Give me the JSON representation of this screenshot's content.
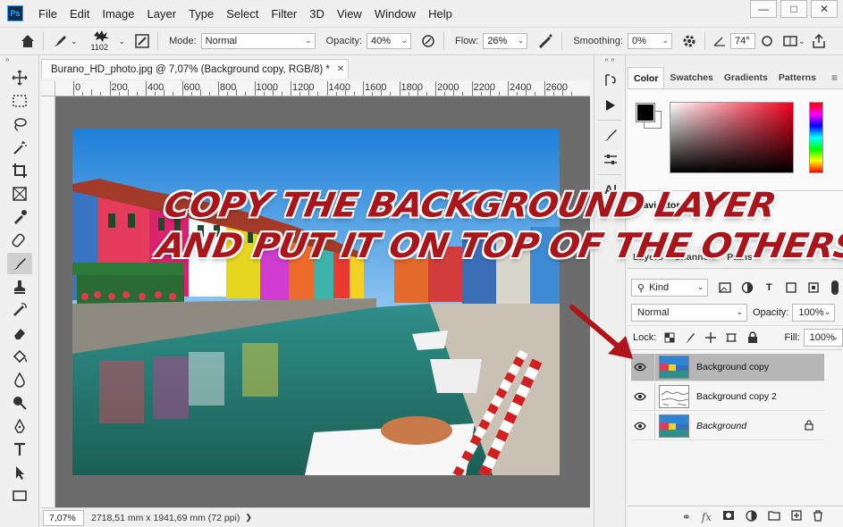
{
  "app": {
    "logo": "Ps",
    "menu": [
      "File",
      "Edit",
      "Image",
      "Layer",
      "Type",
      "Select",
      "Filter",
      "3D",
      "View",
      "Window",
      "Help"
    ],
    "window_controls": [
      "minimize-icon",
      "maximize-icon",
      "close-icon"
    ]
  },
  "options_bar": {
    "brush_size": "1102",
    "mode_label": "Mode:",
    "mode_value": "Normal",
    "opacity_label": "Opacity:",
    "opacity_value": "40%",
    "flow_label": "Flow:",
    "flow_value": "26%",
    "smoothing_label": "Smoothing:",
    "smoothing_value": "0%",
    "angle_value": "74°"
  },
  "tools": [
    "move-icon",
    "marquee-icon",
    "lasso-icon",
    "magic-wand-icon",
    "crop-icon",
    "frame-icon",
    "eyedropper-icon",
    "healing-brush-icon",
    "brush-icon",
    "clone-stamp-icon",
    "history-brush-icon",
    "eraser-icon",
    "paint-bucket-icon",
    "blur-icon",
    "dodge-icon",
    "pen-icon",
    "type-icon",
    "path-selection-icon",
    "rectangle-icon"
  ],
  "document": {
    "tab_title": "Burano_HD_photo.jpg @ 7,07% (Background copy, RGB/8) *",
    "ruler_labels": [
      "0",
      "200",
      "400",
      "600",
      "800",
      "1000",
      "1200",
      "1400",
      "1600",
      "1800",
      "2000",
      "2200",
      "2400",
      "2600"
    ]
  },
  "status_bar": {
    "zoom": "7,07%",
    "doc_info": "2718,51 mm x 1941,69 mm (72 ppi)"
  },
  "color_panel": {
    "tabs": [
      "Color",
      "Swatches",
      "Gradients",
      "Patterns"
    ],
    "active_tab": "Color",
    "foreground": "#000000",
    "background": "#ffffff"
  },
  "navigator_panel": {
    "title": "Navigator"
  },
  "layers_panel": {
    "tabs": [
      "Layers",
      "Channels",
      "Paths"
    ],
    "filter_kind": "Kind",
    "blend_mode": "Normal",
    "opacity_label": "Opacity:",
    "opacity_value": "100%",
    "lock_label": "Lock:",
    "fill_label": "Fill:",
    "fill_value": "100%",
    "layers": [
      {
        "name": "Background copy",
        "selected": true,
        "italic": false,
        "locked": false
      },
      {
        "name": "Background copy 2",
        "selected": false,
        "italic": false,
        "locked": false
      },
      {
        "name": "Background",
        "selected": false,
        "italic": true,
        "locked": true
      }
    ]
  },
  "annotation": {
    "line1": "COPY THE BACKGROUND LAYER",
    "line2": "AND PUT IT ON TOP OF THE OTHERS",
    "color": "#a8151a"
  }
}
